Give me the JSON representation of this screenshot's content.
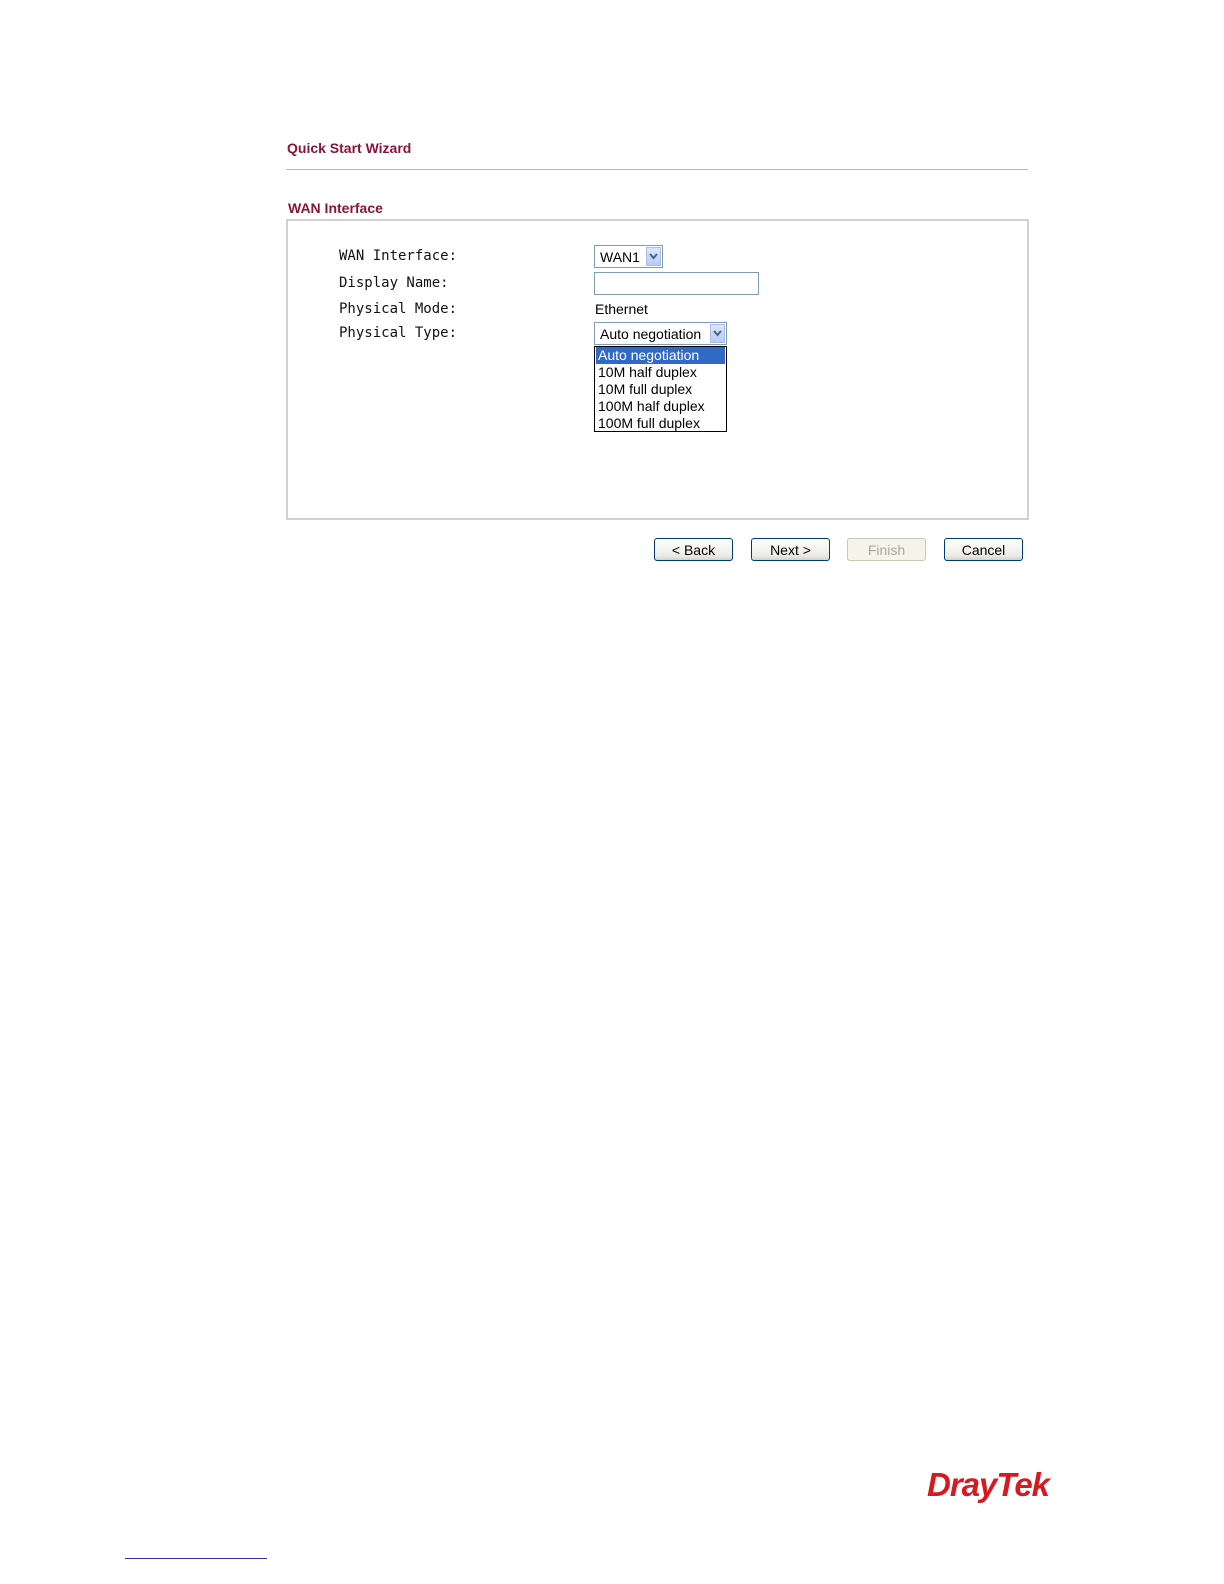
{
  "wizard": {
    "title": "Quick Start Wizard"
  },
  "section": {
    "title": "WAN Interface"
  },
  "form": {
    "wan_interface": {
      "label": "WAN Interface:",
      "value": "WAN1"
    },
    "display_name": {
      "label": "Display Name:",
      "value": ""
    },
    "physical_mode": {
      "label": "Physical Mode:",
      "value": "Ethernet"
    },
    "physical_type": {
      "label": "Physical Type:",
      "value": "Auto negotiation",
      "options": [
        "Auto negotiation",
        "10M half duplex",
        "10M full duplex",
        "100M half duplex",
        "100M full duplex"
      ],
      "highlighted": "Auto negotiation"
    }
  },
  "buttons": {
    "back": "< Back",
    "next": "Next >",
    "finish": "Finish",
    "cancel": "Cancel"
  },
  "logo": {
    "text": "DrayTek",
    "color": "#d71920"
  },
  "colors": {
    "heading": "#8b1538",
    "selection": "#316ac5",
    "field_border": "#7f9db9"
  }
}
